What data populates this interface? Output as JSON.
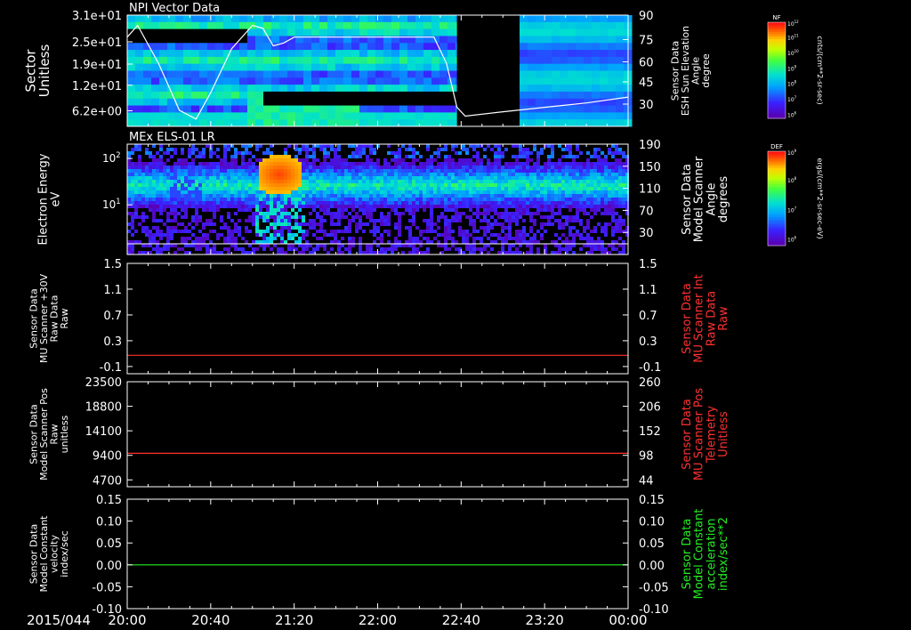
{
  "date_label": "2015/044",
  "time_ticks": [
    "20:00",
    "20:40",
    "21:20",
    "22:00",
    "22:40",
    "23:20",
    "00:00"
  ],
  "colors": {
    "background": "#000000",
    "foreground": "#ffffff",
    "red_trace": "#ff3030",
    "green_trace": "#22ee22"
  },
  "colorbars": [
    {
      "title": "NF",
      "top_label": "10^12",
      "labels": [
        "10^11",
        "10^10",
        "10^9",
        "10^8",
        "10^7",
        "10^6"
      ],
      "unit": "cnts/(cm**2-sr-sec)"
    },
    {
      "title": "DEF",
      "top_label": "10^9",
      "labels": [
        "10^8",
        "10^7",
        "10^6"
      ],
      "unit": "ergs/(cm**2-sr-sec-eV)"
    }
  ],
  "chart_data": [
    {
      "type": "heatmap",
      "title": "NPI Vector Data",
      "ylabel": "Sector\nUnitless",
      "yticks": [
        "3.1e+01",
        "2.5e+01",
        "1.9e+01",
        "1.2e+01",
        "6.2e+00"
      ],
      "right_ylabel": "Sensor Data\nESH Sun Elevation\nAngle\ndegree",
      "right_yticks": [
        "90",
        "75",
        "60",
        "45",
        "30"
      ],
      "data_gap": [
        "22:38",
        "23:07"
      ],
      "overlay_line": {
        "name": "ESH Sun Elevation Angle",
        "x": [
          "20:00",
          "20:05",
          "20:15",
          "20:25",
          "20:33",
          "20:40",
          "20:50",
          "21:00",
          "21:05",
          "21:10",
          "21:15",
          "21:20",
          "21:25",
          "21:35",
          "21:45",
          "22:00",
          "22:15",
          "22:27",
          "22:33",
          "22:38",
          "22:42",
          "23:00",
          "23:20",
          "23:40",
          "00:00"
        ],
        "y": [
          78,
          86,
          60,
          28,
          22,
          40,
          70,
          86,
          84,
          72,
          74,
          78,
          78,
          78,
          78,
          78,
          78,
          78,
          60,
          30,
          24,
          27,
          30,
          33,
          37
        ]
      }
    },
    {
      "type": "heatmap",
      "title": "MEx ELS-01 LR",
      "ylabel": "Electron Energy\neV",
      "yticks": [
        "10^2",
        "10^1"
      ],
      "right_ylabel": "Sensor Data\nModel Scanner\nAngle\ndegrees",
      "right_yticks": [
        "190",
        "150",
        "110",
        "70",
        "30"
      ]
    },
    {
      "type": "line",
      "ylabel": "Sensor Data\nMU Scanner +30V\nRaw Data\nRaw",
      "yticks": [
        "1.5",
        "1.1",
        "0.7",
        "0.3",
        "-0.1"
      ],
      "ylim": [
        -0.3,
        1.5
      ],
      "right_ylabel": "Sensor Data\nMU Scanner Int\nRaw Data\nRaw",
      "right_yticks": [
        "1.5",
        "1.1",
        "0.7",
        "0.3",
        "-0.1"
      ],
      "series": [
        {
          "x": [
            "20:00",
            "00:00"
          ],
          "y": [
            0.0,
            0.0
          ]
        }
      ]
    },
    {
      "type": "line",
      "ylabel": "Sensor Data\nModel Scanner Pos\nRaw\nunitless",
      "yticks": [
        "23500",
        "18800",
        "14100",
        "9400",
        "4700"
      ],
      "ylim": [
        0,
        23500
      ],
      "right_ylabel": "Sensor Data\nMU Scanner Pos\nTelemetry\nUnitless",
      "right_yticks": [
        "260",
        "206",
        "152",
        "98",
        "44"
      ],
      "series": [
        {
          "x": [
            "20:00",
            "00:00"
          ],
          "y": [
            7500,
            7500
          ]
        }
      ]
    },
    {
      "type": "line",
      "ylabel": "Sensor Data\nModel Constant\nvelocity\nindex/sec",
      "yticks": [
        "0.15",
        "0.10",
        "0.05",
        "0.00",
        "-0.05",
        "-0.10"
      ],
      "ylim": [
        -0.1,
        0.15
      ],
      "right_ylabel": "Sensor Data\nModel Constant\nacceleration\nindex/sec**2",
      "right_yticks": [
        "0.15",
        "0.10",
        "0.05",
        "0.00",
        "-0.05",
        "-0.10"
      ],
      "series": [
        {
          "x": [
            "20:00",
            "00:00"
          ],
          "y": [
            0.0,
            0.0
          ]
        }
      ]
    }
  ]
}
